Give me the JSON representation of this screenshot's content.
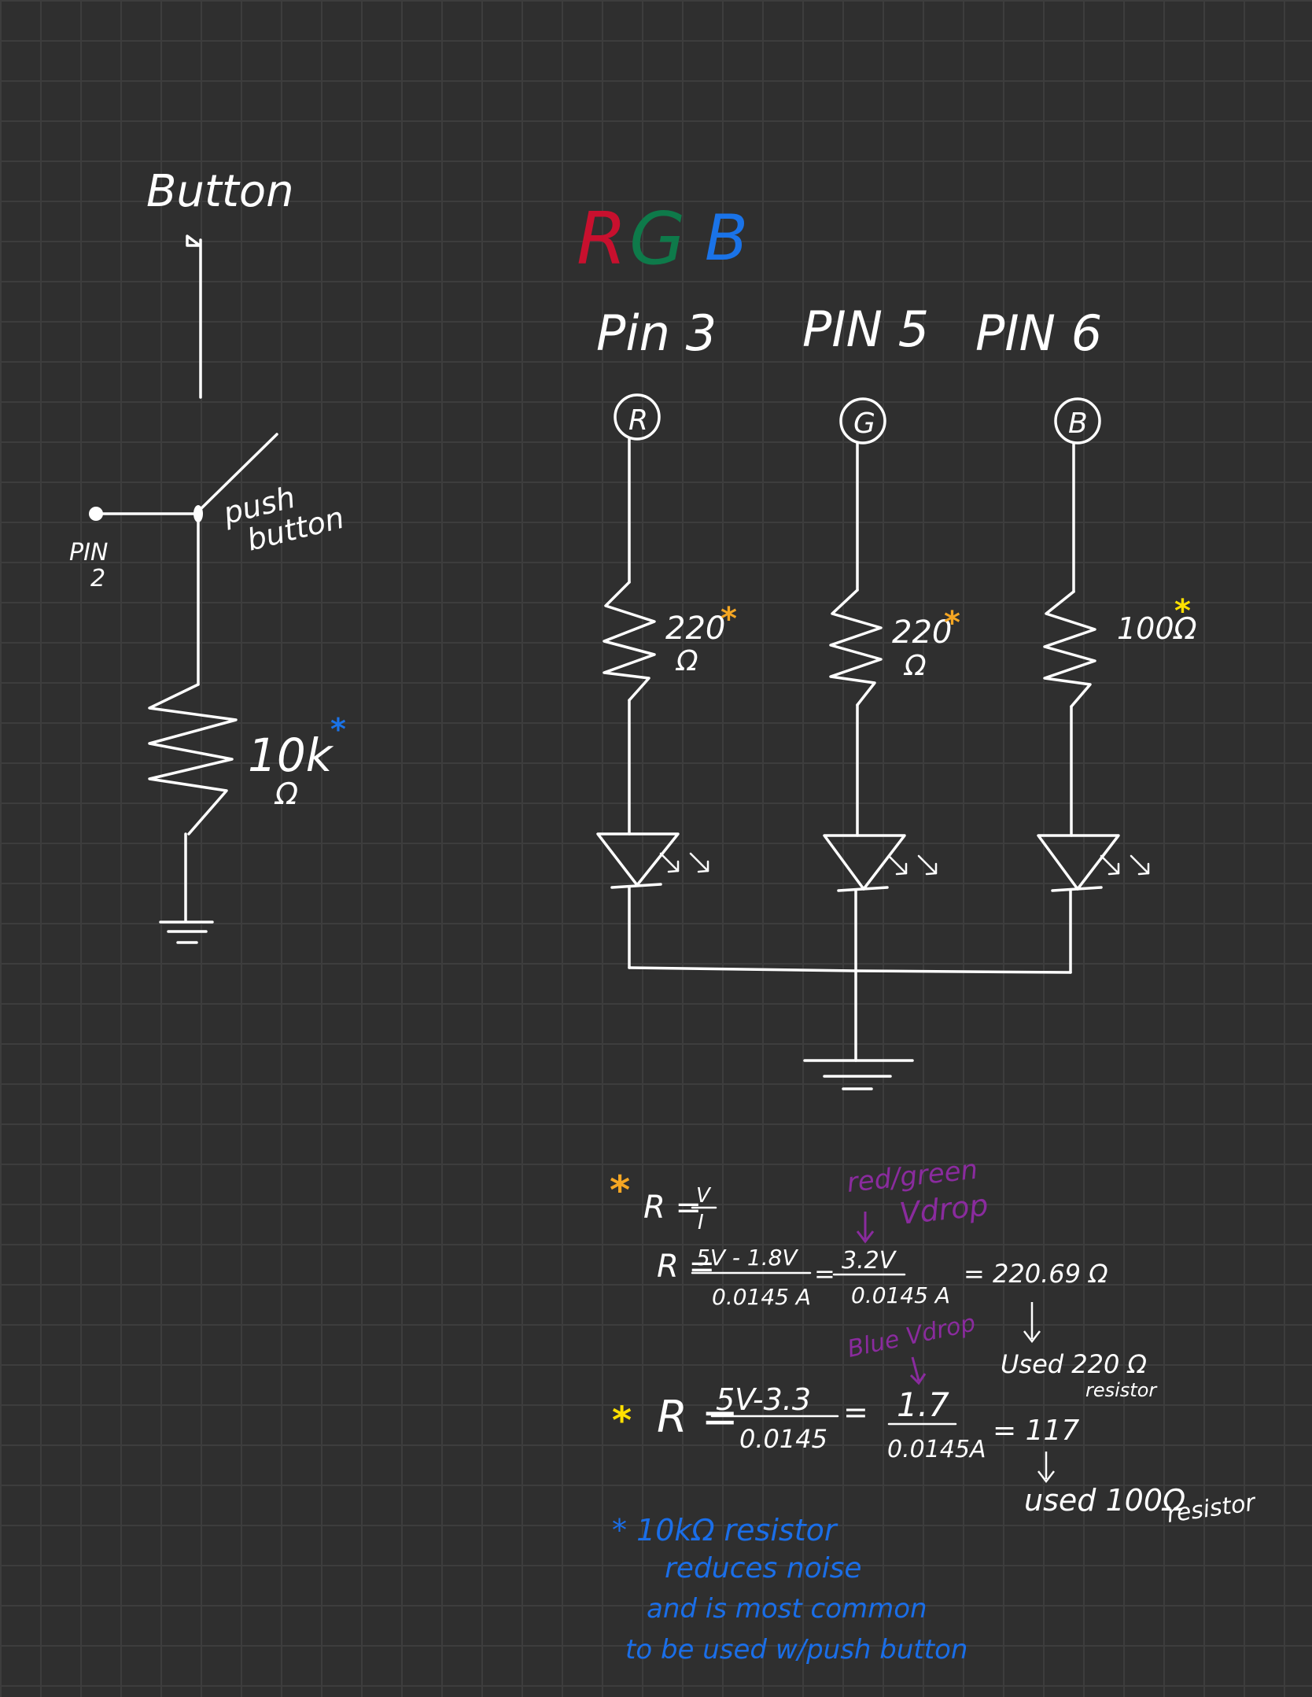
{
  "colors": {
    "background": "#2f2f2f",
    "grid": "#3d3d3d",
    "ink": "#ffffff",
    "red": "#c8102e",
    "green": "#0e7a4a",
    "blue": "#1a73e8",
    "orange": "#f5a623",
    "yellow": "#ffe000",
    "purple": "#8a2b9e",
    "note_blue": "#1a6ee8"
  },
  "button_circuit": {
    "title": "Button",
    "pin_label_line1": "PIN",
    "pin_label_line2": "2",
    "switch_label_line1": "push",
    "switch_label_line2": "button",
    "resistor_value": "10k",
    "resistor_unit": "Ω",
    "marker": "*",
    "marker_color": "blue"
  },
  "rgb_circuit": {
    "heading": {
      "r": "R",
      "g": "G",
      "b": "B"
    },
    "channels": [
      {
        "pin": "Pin 3",
        "node": "R",
        "resistor": "220",
        "unit": "Ω",
        "marker": "*",
        "marker_color": "orange"
      },
      {
        "pin": "PIN 5",
        "node": "G",
        "resistor": "220",
        "unit": "Ω",
        "marker": "*",
        "marker_color": "orange"
      },
      {
        "pin": "PIN 6",
        "node": "B",
        "resistor": "100Ω",
        "unit": "",
        "marker": "*",
        "marker_color": "yellow"
      }
    ]
  },
  "calculations": {
    "red_green": {
      "marker": "*",
      "formula": "R = V/I",
      "formula_r": "R =",
      "formula_v": "V",
      "formula_i": "I",
      "vdrop_note_line1": "red/green",
      "vdrop_note_line2": "Vdrop",
      "line_r": "R =",
      "numerator": "5V - 1.8V",
      "denominator": "0.0145 A",
      "eq": "=",
      "numerator2": "3.2V",
      "denominator2": "0.0145 A",
      "result": "= 220.69 Ω",
      "used": "Used 220 Ω",
      "used_sub": "resistor"
    },
    "blue": {
      "marker": "*",
      "vdrop_note": "Blue Vdrop",
      "line_r": "R =",
      "numerator": "5V-3.3",
      "denominator": "0.0145",
      "eq": "=",
      "numerator2": "1.7",
      "denominator2": "0.0145A",
      "result": "= 117",
      "used": "used 100Ω",
      "used_sub": "resistor"
    }
  },
  "note": {
    "lines": [
      "* 10kΩ resistor",
      "reduces noise",
      "and is most common",
      "to be used w/push button"
    ]
  }
}
